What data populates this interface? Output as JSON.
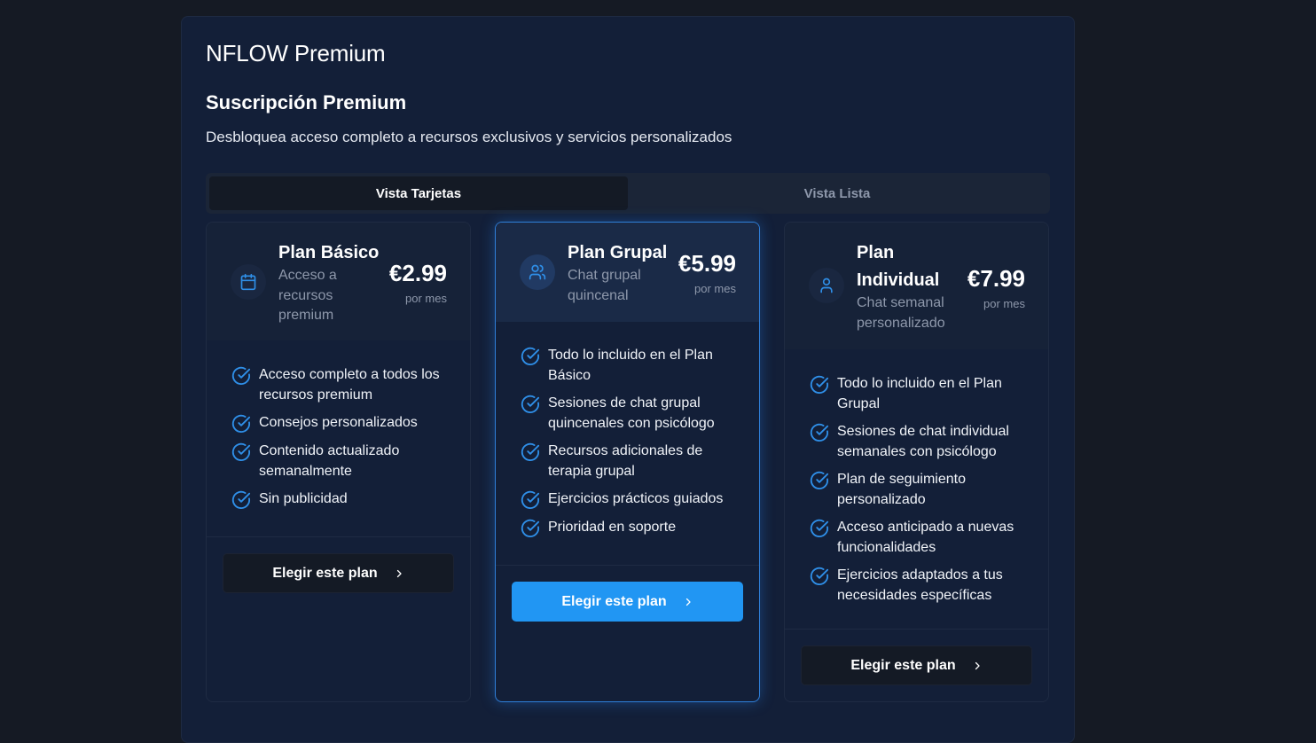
{
  "app": {
    "title": "NFLOW Premium"
  },
  "section": {
    "title": "Suscripción Premium",
    "subtitle": "Desbloquea acceso completo a recursos exclusivos y servicios personalizados"
  },
  "tabs": [
    {
      "label": "Vista Tarjetas",
      "active": true
    },
    {
      "label": "Vista Lista",
      "active": false
    }
  ],
  "plans": [
    {
      "name": "Plan Básico",
      "description": "Acceso a recursos premium",
      "price": "€2.99",
      "period": "por mes",
      "icon": "calendar-icon",
      "features": [
        "Acceso completo a todos los recursos premium",
        "Consejos personalizados",
        "Contenido actualizado semanalmente",
        "Sin publicidad"
      ],
      "cta": "Elegir este plan"
    },
    {
      "name": "Plan Grupal",
      "description": "Chat grupal quincenal",
      "price": "€5.99",
      "period": "por mes",
      "icon": "users-icon",
      "features": [
        "Todo lo incluido en el Plan Básico",
        "Sesiones de chat grupal quincenales con psicólogo",
        "Recursos adicionales de terapia grupal",
        "Ejercicios prácticos guiados",
        "Prioridad en soporte"
      ],
      "cta": "Elegir este plan"
    },
    {
      "name": "Plan Individual",
      "description": "Chat semanal personalizado",
      "price": "€7.99",
      "period": "por mes",
      "icon": "user-icon",
      "features": [
        "Todo lo incluido en el Plan Grupal",
        "Sesiones de chat individual semanales con psicólogo",
        "Plan de seguimiento personalizado",
        "Acceso anticipado a nuevas funcionalidades",
        "Ejercicios adaptados a tus necesidades específicas"
      ],
      "cta": "Elegir este plan"
    }
  ],
  "colors": {
    "accent": "#2196f3",
    "check": "#2f8fe8",
    "background": "#151a24",
    "panel": "#131f38"
  }
}
